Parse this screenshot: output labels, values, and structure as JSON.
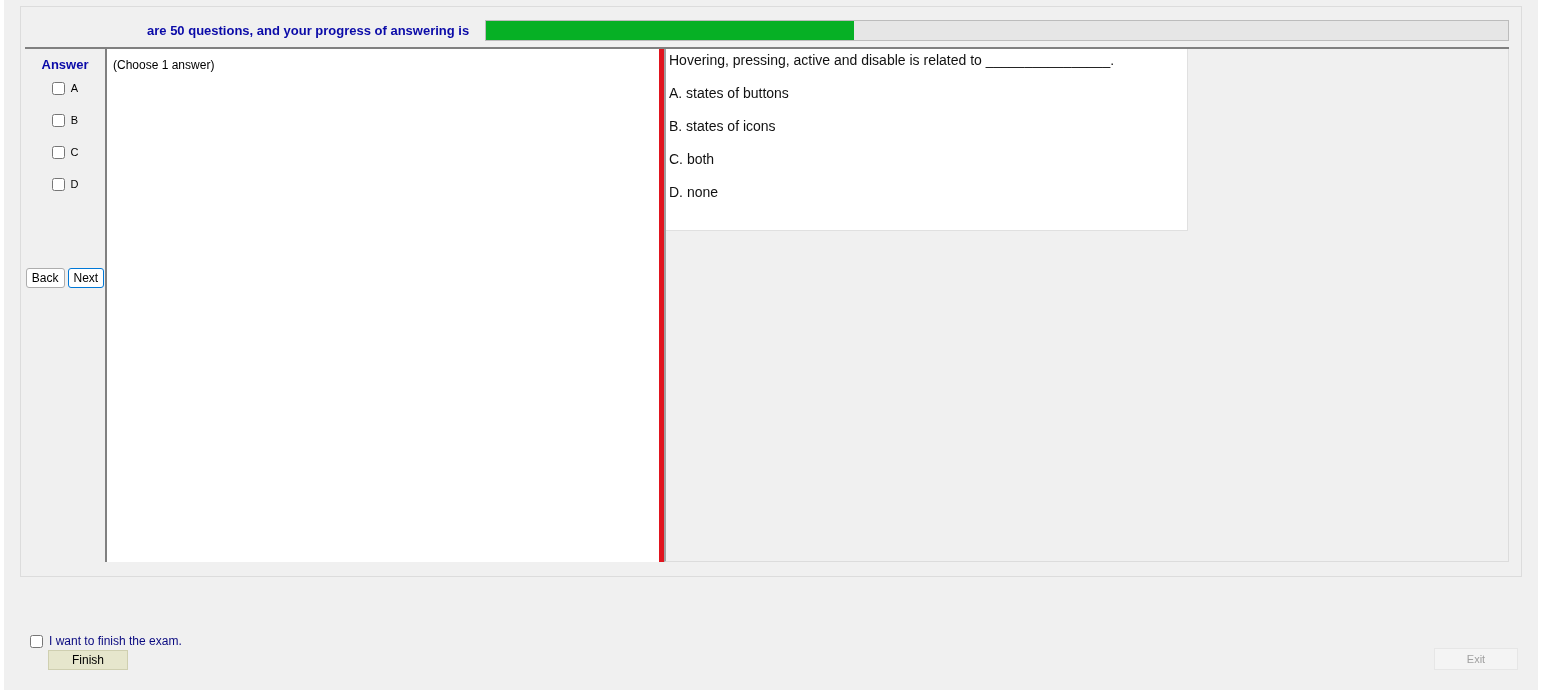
{
  "header": {
    "text": "are 50 questions, and your progress of answering is",
    "progress": {
      "level": 0.36
    }
  },
  "answer_panel": {
    "title": "Answer",
    "options": [
      {
        "label": "A",
        "checked": false
      },
      {
        "label": "B",
        "checked": false
      },
      {
        "label": "C",
        "checked": false
      },
      {
        "label": "D",
        "checked": false
      }
    ],
    "buttons": [
      "Back",
      "Next"
    ]
  },
  "answer_area": {
    "hint": "(Choose 1 answer)"
  },
  "question": {
    "text": "Hovering, pressing, active and disable is related to ________________.",
    "choices": [
      "A.  states of buttons",
      "B.  states of icons",
      "C.  both",
      "D.  none"
    ]
  },
  "finish": {
    "label": "I want to finish the exam.",
    "checked": false,
    "button": "Finish"
  },
  "exit_button": {
    "label": "Exit",
    "disabled": true
  }
}
